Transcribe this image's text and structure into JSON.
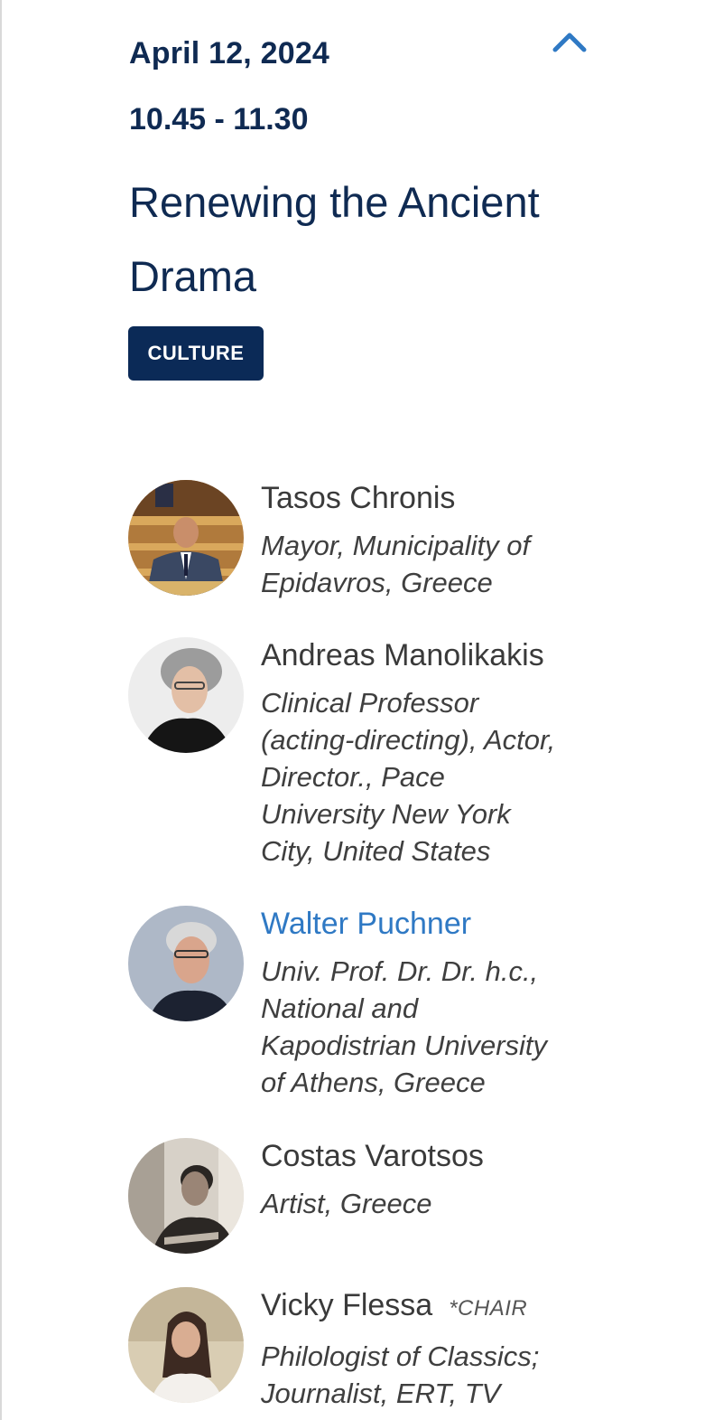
{
  "session": {
    "date": "April 12, 2024",
    "time": "10.45 - 11.30",
    "title": "Renewing the Ancient Drama",
    "tag": "CULTURE",
    "accent_color": "#2f79c4",
    "tag_color": "#0b2a57"
  },
  "speakers": [
    {
      "name": "Tasos Chronis",
      "role": "Mayor, Municipality of\nEpidavros, Greece",
      "chair_label": ""
    },
    {
      "name": "Andreas Manolikakis",
      "role": "Clinical Professor\n(acting-directing), Actor,\nDirector., Pace\nUniversity New York\nCity, United States",
      "chair_label": ""
    },
    {
      "name": "Walter Puchner",
      "role": "Univ. Prof. Dr. Dr. h.c.,\nNational and\nKapodistrian University\nof Athens, Greece",
      "chair_label": ""
    },
    {
      "name": "Costas Varotsos",
      "role": "Artist, Greece",
      "chair_label": ""
    },
    {
      "name": "Vicky Flessa",
      "role": "Philologist of Classics;\nJournalist, ERT, TV",
      "chair_label": "*CHAIR"
    }
  ],
  "icons": {
    "collapse": "chevron-up-icon"
  }
}
